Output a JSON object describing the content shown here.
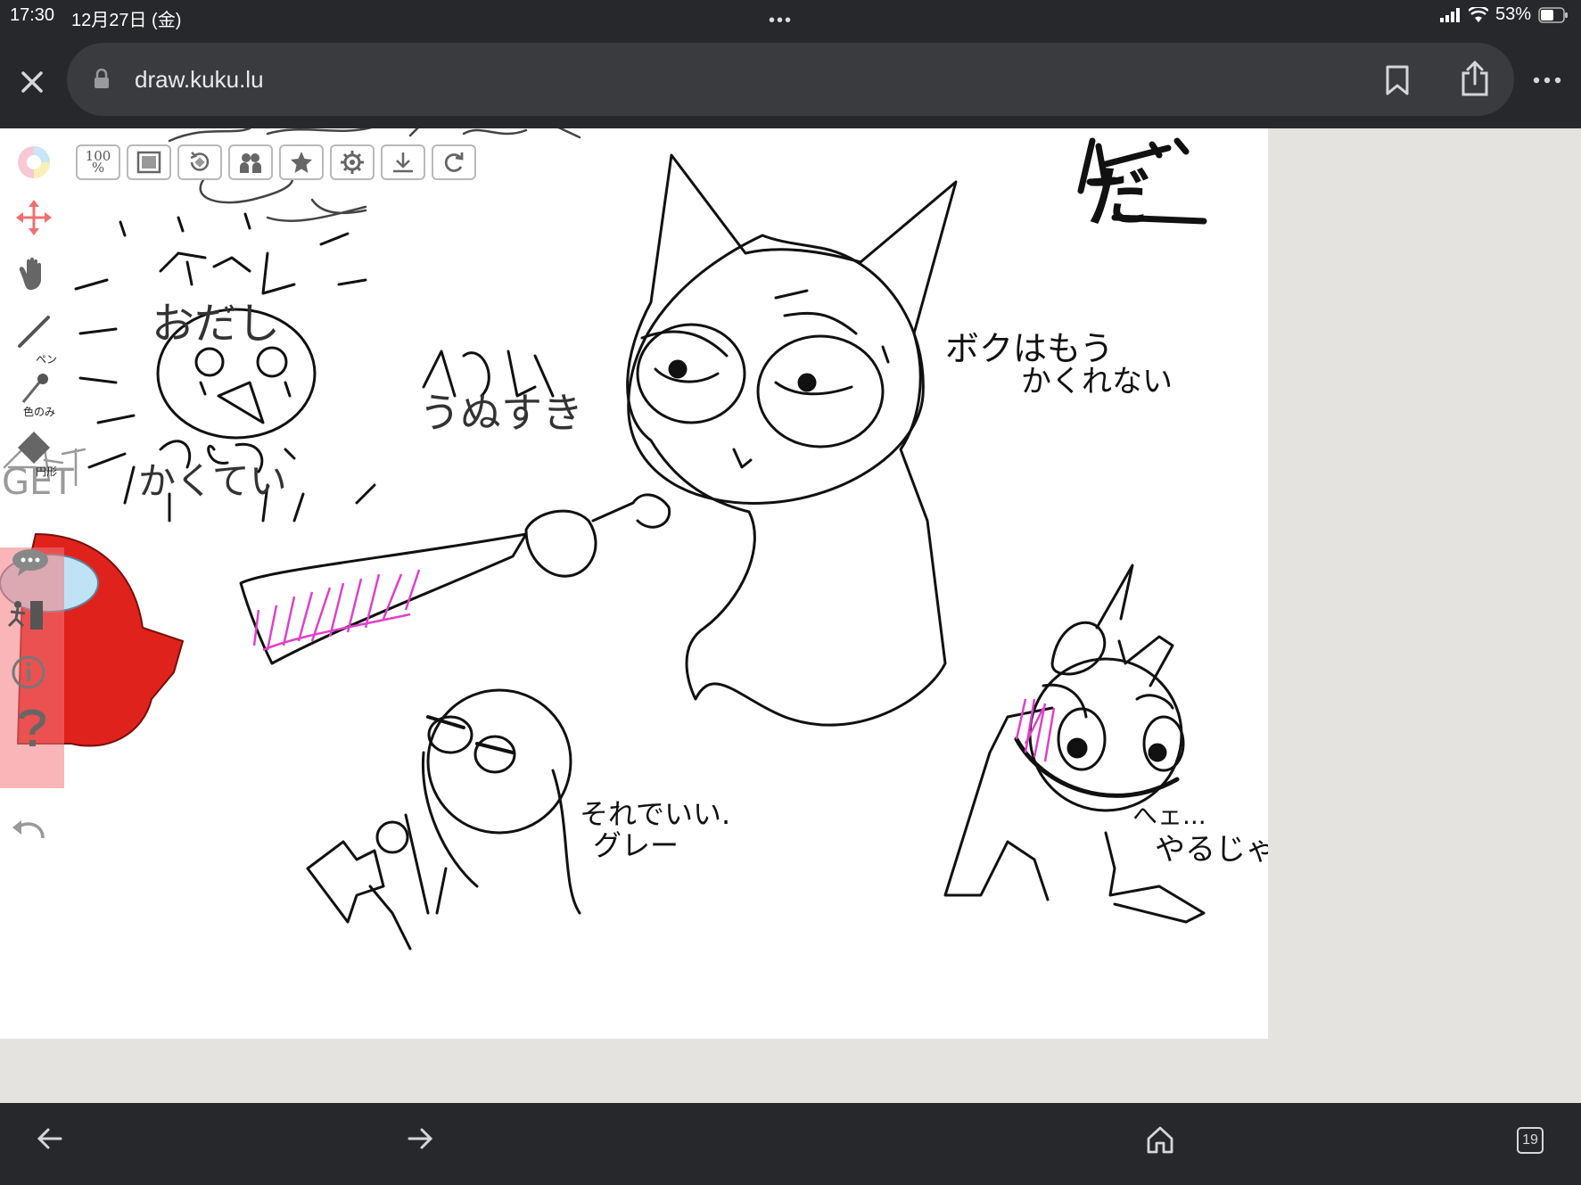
{
  "status": {
    "time": "17:30",
    "date": "12月27日 (金)",
    "battery": "53%"
  },
  "browser": {
    "url": "draw.kuku.lu",
    "tab_count": "19"
  },
  "canvas_toolbar": {
    "zoom_label_top": "100",
    "zoom_label_bottom": "%"
  },
  "side_tools": {
    "pen_label": "ペン",
    "color_label": "色のみ",
    "shape_label": "円形"
  },
  "drawing_text": {
    "top_right": "だ",
    "cat_speech_1": "ボクはもう",
    "cat_speech_2": "かくれない",
    "left_1": "おだし",
    "left_2": "かくてい",
    "left_3": "うぬすき",
    "left_4": "GET",
    "bottom_mid_1": "それでいい.",
    "bottom_mid_2": "グレー",
    "bottom_right_1": "へェ...",
    "bottom_right_2": "やるじゃん"
  },
  "colors": {
    "chrome": "#27282b",
    "urlbar": "#3a3b3f",
    "accent_pink": "#e040c8",
    "red": "#e0221c"
  }
}
